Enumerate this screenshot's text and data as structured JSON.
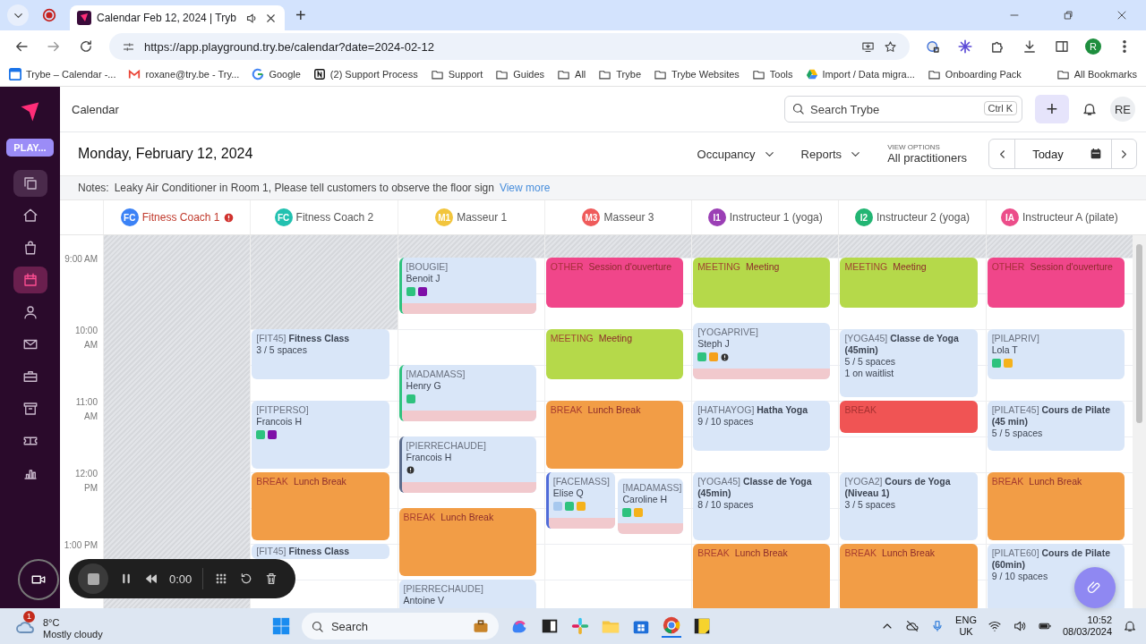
{
  "browser": {
    "tab_title": "Calendar Feb 12, 2024 | Tryb",
    "new_tab": "+",
    "url": "https://app.playground.try.be/calendar?date=2024-02-12",
    "profile": "R",
    "bookmarks": [
      {
        "kind": "calendar",
        "label": "Trybe – Calendar -..."
      },
      {
        "kind": "mail",
        "label": "roxane@try.be - Try..."
      },
      {
        "kind": "google",
        "label": "Google"
      },
      {
        "kind": "notion",
        "label": "(2) Support Process"
      },
      {
        "kind": "folder",
        "label": "Support"
      },
      {
        "kind": "folder",
        "label": "Guides"
      },
      {
        "kind": "folder",
        "label": "All"
      },
      {
        "kind": "folder",
        "label": "Trybe"
      },
      {
        "kind": "folder",
        "label": "Trybe Websites"
      },
      {
        "kind": "folder",
        "label": "Tools"
      },
      {
        "kind": "drive",
        "label": "Import / Data migra..."
      },
      {
        "kind": "folder",
        "label": "Onboarding Pack"
      }
    ],
    "all_bookmarks": "All Bookmarks"
  },
  "sidebar": {
    "workspace": "PLAY...",
    "nav": [
      {
        "kind": "copy",
        "selected": false
      },
      {
        "kind": "home",
        "selected": false
      },
      {
        "kind": "bag",
        "selected": false
      },
      {
        "kind": "calendar",
        "selected": true
      },
      {
        "kind": "people",
        "selected": false
      },
      {
        "kind": "mail",
        "selected": false
      },
      {
        "kind": "briefcase",
        "selected": false
      },
      {
        "kind": "archive",
        "selected": false
      },
      {
        "kind": "ticket",
        "selected": false
      },
      {
        "kind": "chart",
        "selected": false
      }
    ]
  },
  "header": {
    "title": "Calendar",
    "search": {
      "placeholder": "Search Trybe",
      "shortcut": "Ctrl K"
    },
    "add": "+",
    "user": "RE"
  },
  "toolbar": {
    "date": "Monday, February 12, 2024",
    "menus": [
      "Occupancy",
      "Reports"
    ],
    "view_options": {
      "label": "VIEW OPTIONS",
      "value": "All practitioners"
    },
    "today": "Today"
  },
  "notes": {
    "label": "Notes:",
    "text": "Leaky Air Conditioner in Room 1, Please tell customers to observe the floor sign",
    "link": "View more"
  },
  "calendar": {
    "times": [
      "9:00 AM",
      "10:00 AM",
      "11:00 AM",
      "12:00 PM",
      "1:00 PM"
    ],
    "columns": [
      {
        "initials": "FC",
        "name": "Fitness Coach 1",
        "color": "#3b82f6",
        "alert": true
      },
      {
        "initials": "FC",
        "name": "Fitness Coach 2",
        "color": "#22c1b0",
        "alert": false,
        "events": [
          {
            "kind": "class",
            "heading": "[FIT45] **Fitness Class**",
            "lines": [
              "3 / 5 spaces"
            ]
          },
          {
            "kind": "appointment",
            "code": "[FITPERSO]",
            "client": "Francois H",
            "buffer": false,
            "alert": false,
            "dots": [
              {
                "color": "#2ec27e"
              },
              {
                "color": "#7e0fa8"
              }
            ]
          },
          {
            "kind": "block",
            "category": "BREAK",
            "title": "Lunch Break",
            "color": "#f29d46"
          },
          {
            "kind": "class",
            "heading": "[FIT45] **Fitness Class**"
          }
        ]
      },
      {
        "initials": "M1",
        "name": "Masseur 1",
        "color": "#f2c53d",
        "alert": false,
        "events": [
          {
            "kind": "appointment",
            "code": "[BOUGIE]",
            "client": "Benoit J",
            "color": "#2ec27e",
            "buffer": true,
            "alert": false,
            "dots": [
              {
                "color": "#2ec27e"
              },
              {
                "color": "#7e0fa8"
              }
            ]
          },
          {
            "kind": "appointment",
            "code": "[MADAMASS]",
            "client": "Henry G",
            "color": "#2ec27e",
            "buffer": true,
            "alert": false,
            "dots": [
              {
                "color": "#2ec27e"
              }
            ]
          },
          {
            "kind": "appointment",
            "code": "[PIERRECHAUDE]",
            "client": "Francois H",
            "color": "#5a6b8c",
            "buffer": true,
            "alert": true
          },
          {
            "kind": "block",
            "category": "BREAK",
            "title": "Lunch Break",
            "color": "#f29d46"
          },
          {
            "kind": "appointment",
            "code": "[PIERRECHAUDE]",
            "client": "Antoine V",
            "buffer": false,
            "alert": false
          }
        ]
      },
      {
        "initials": "M3",
        "name": "Masseur 3",
        "color": "#ef5b5b",
        "alert": false,
        "events": [
          {
            "kind": "block",
            "category": "OTHER",
            "title": "Session d'ouverture",
            "color": "#f0468a"
          },
          {
            "kind": "block",
            "category": "MEETING",
            "title": "Meeting",
            "color": "#b5d94a"
          },
          {
            "kind": "block",
            "category": "BREAK",
            "title": "Lunch Break",
            "color": "#f29d46"
          },
          {
            "kind": "appointment",
            "code": "[FACEMASS]",
            "client": "Elise Q",
            "color": "#4f6bd8",
            "buffer": true,
            "alert": false,
            "dots": [
              {
                "color": "#a7c8ee"
              },
              {
                "color": "#2ec27e"
              },
              {
                "color": "#f5b21b"
              }
            ]
          },
          {
            "kind": "appointment",
            "code": "[MADAMASS]",
            "client": "Caroline H",
            "buffer": true,
            "alert": false,
            "dots": [
              {
                "color": "#2ec27e"
              },
              {
                "color": "#f5b21b"
              }
            ]
          }
        ]
      },
      {
        "initials": "I1",
        "name": "Instructeur 1 (yoga)",
        "color": "#9b3fb5",
        "alert": false,
        "events": [
          {
            "kind": "block",
            "category": "MEETING",
            "title": "Meeting",
            "color": "#b5d94a"
          },
          {
            "kind": "appointment",
            "code": "[YOGAPRIVE]",
            "client": "Steph J",
            "buffer": true,
            "alert": true,
            "dots": [
              {
                "color": "#2ec27e"
              },
              {
                "color": "#f5a11b"
              }
            ]
          },
          {
            "kind": "class",
            "heading": "[HATHAYOG] **Hatha Yoga**",
            "lines": [
              "9 / 10 spaces"
            ]
          },
          {
            "kind": "class",
            "heading": "[YOGA45] **Classe de Yoga (45min)**",
            "lines": [
              "8 / 10 spaces"
            ]
          },
          {
            "kind": "block",
            "category": "BREAK",
            "title": "Lunch Break",
            "color": "#f29d46"
          }
        ]
      },
      {
        "initials": "I2",
        "name": "Instructeur 2 (yoga)",
        "color": "#22b573",
        "alert": false,
        "events": [
          {
            "kind": "block",
            "category": "MEETING",
            "title": "Meeting",
            "color": "#b5d94a"
          },
          {
            "kind": "class",
            "heading": "[YOGA45] **Classe de Yoga (45min)**",
            "lines": [
              "5 / 5 spaces",
              "1 on waitlist"
            ]
          },
          {
            "kind": "block",
            "category": "BREAK",
            "color": "#f05454"
          },
          {
            "kind": "class",
            "heading": "[YOGA2] **Cours de Yoga (Niveau 1)**",
            "lines": [
              "3 / 5 spaces"
            ]
          },
          {
            "kind": "block",
            "category": "BREAK",
            "title": "Lunch Break",
            "color": "#f29d46"
          }
        ]
      },
      {
        "initials": "IA",
        "name": "Instructeur A (pilate)",
        "color": "#ec4d8a",
        "alert": false,
        "events": [
          {
            "kind": "block",
            "category": "OTHER",
            "title": "Session d'ouverture",
            "color": "#f0468a"
          },
          {
            "kind": "appointment",
            "code": "[PILAPRIV]",
            "client": "Lola T",
            "buffer": false,
            "alert": false,
            "dots": [
              {
                "color": "#2ec27e"
              },
              {
                "color": "#f5b21b"
              }
            ]
          },
          {
            "kind": "class",
            "heading": "[PILATE45] **Cours de Pilate (45 min)**",
            "lines": [
              "5 / 5 spaces"
            ]
          },
          {
            "kind": "block",
            "category": "BREAK",
            "title": "Lunch Break",
            "color": "#f29d46"
          },
          {
            "kind": "class",
            "heading": "[PILATE60] **Cours de Pilate (60min)**",
            "lines": [
              "9 / 10 spaces"
            ]
          }
        ]
      }
    ]
  },
  "recorder": {
    "time": "0:00"
  },
  "taskbar": {
    "weather": {
      "badge": "1",
      "temp": "8°C",
      "condition": "Mostly cloudy"
    },
    "search": "Search",
    "language": [
      "ENG",
      "UK"
    ],
    "time": "10:52",
    "date": "08/03/2024"
  }
}
